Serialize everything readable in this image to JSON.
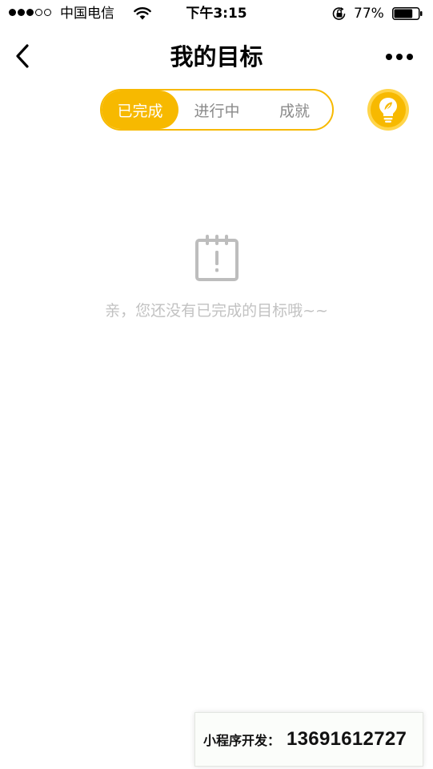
{
  "status_bar": {
    "signal_dots": [
      true,
      true,
      true,
      false,
      false
    ],
    "carrier": "中国电信",
    "time": "下午3:15",
    "battery_percent_label": "77%",
    "battery_level": 0.77,
    "icons": [
      "wifi-icon",
      "orientation-lock-icon",
      "battery-icon"
    ]
  },
  "nav": {
    "title": "我的目标",
    "back_icon": "chevron-left-icon",
    "more_icon": "more-dots-icon"
  },
  "tabs": [
    {
      "label": "已完成",
      "active": true
    },
    {
      "label": "进行中",
      "active": false
    },
    {
      "label": "成就",
      "active": false
    }
  ],
  "tip_button": {
    "icon": "lightbulb-icon"
  },
  "empty_state": {
    "icon": "calendar-alert-icon",
    "message": "亲，您还没有已完成的目标哦~~"
  },
  "watermark": {
    "label": "小程序开发：",
    "phone": "13691612727"
  },
  "colors": {
    "accent": "#f7b900",
    "accent_light": "#ffd54a",
    "inactive_tab_text": "#8a8a8a",
    "empty_text": "#c2c2c2",
    "empty_icon": "#bdbdbd"
  }
}
